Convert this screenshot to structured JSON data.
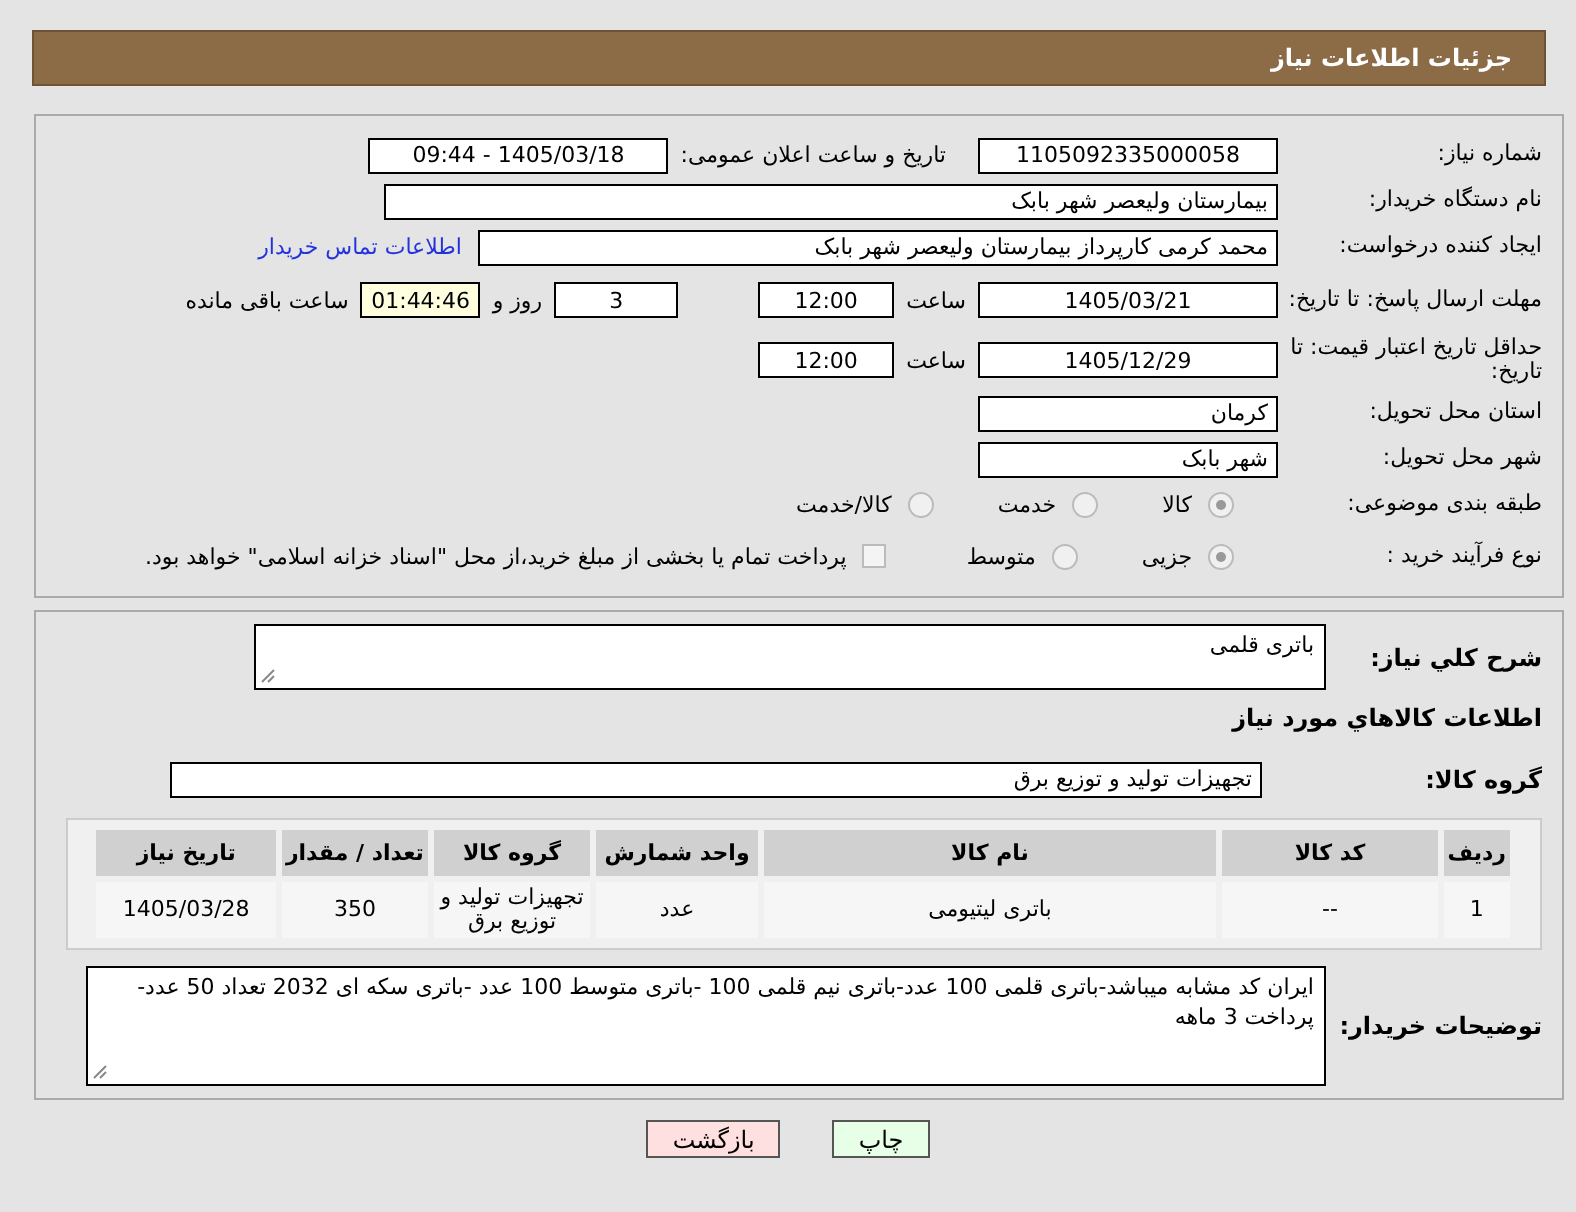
{
  "header": {
    "title": "جزئیات اطلاعات نیاز"
  },
  "need_number": {
    "label": "شماره نیاز:",
    "value": "1105092335000058"
  },
  "announce": {
    "label": "تاریخ و ساعت اعلان عمومی:",
    "value": "1405/03/18 - 09:44"
  },
  "buyer_org": {
    "label": "نام دستگاه خریدار:",
    "value": "بیمارستان ولیعصر شهر بابک"
  },
  "requester": {
    "label": "ایجاد کننده درخواست:",
    "value": "محمد  کرمی  کارپرداز  بیمارستان ولیعصر شهر بابک",
    "link": "اطلاعات تماس خریدار"
  },
  "reply_deadline": {
    "label": "مهلت ارسال پاسخ: تا تاریخ:",
    "date": "1405/03/21",
    "time_label": "ساعت",
    "time": "12:00",
    "days": "3",
    "days_label": "روز و",
    "remaining": "01:44:46",
    "remaining_label": "ساعت باقی مانده"
  },
  "price_validity": {
    "label": "حداقل تاریخ اعتبار قیمت: تا تاریخ:",
    "date": "1405/12/29",
    "time_label": "ساعت",
    "time": "12:00"
  },
  "province": {
    "label": "استان محل تحویل:",
    "value": "کرمان"
  },
  "city": {
    "label": "شهر محل تحویل:",
    "value": "شهر بابک"
  },
  "category": {
    "label": "طبقه بندی موضوعی:",
    "options": [
      {
        "label": "کالا",
        "selected": true
      },
      {
        "label": "خدمت",
        "selected": false
      },
      {
        "label": "کالا/خدمت",
        "selected": false
      }
    ]
  },
  "process": {
    "label": "نوع فرآیند خرید :",
    "options": [
      {
        "label": "جزیی",
        "selected": true
      },
      {
        "label": "متوسط",
        "selected": false
      }
    ],
    "payment": {
      "label": "پرداخت تمام یا بخشی از مبلغ خرید،از محل \"اسناد خزانه اسلامی\" خواهد بود.",
      "checked": false
    }
  },
  "description": {
    "label": "شرح کلي نياز:",
    "value": "باتری قلمی"
  },
  "items_title": "اطلاعات کالاهاي مورد نياز",
  "goods_group": {
    "label": "گروه کالا:",
    "value": "تجهیزات تولید و توزیع برق"
  },
  "table": {
    "columns": [
      "ردیف",
      "کد کالا",
      "نام کالا",
      "واحد شمارش",
      "گروه کالا",
      "تعداد / مقدار",
      "تاریخ نیاز"
    ],
    "rows": [
      [
        "1",
        "--",
        "باتری لیتیومی",
        "عدد",
        "تجهیزات تولید و توزیع برق",
        "350",
        "1405/03/28"
      ]
    ]
  },
  "buyer_notes": {
    "label": "توضیحات خریدار:",
    "value": "ایران کد مشابه میباشد-باتری قلمی 100 عدد-باتری نیم قلمی 100 -باتری متوسط 100 عدد -باتری سکه ای 2032 تعداد 50 عدد-پرداخت 3 ماهه"
  },
  "buttons": [
    {
      "label": "چاپ",
      "kind": "print"
    },
    {
      "label": "بازگشت",
      "kind": "back"
    }
  ]
}
